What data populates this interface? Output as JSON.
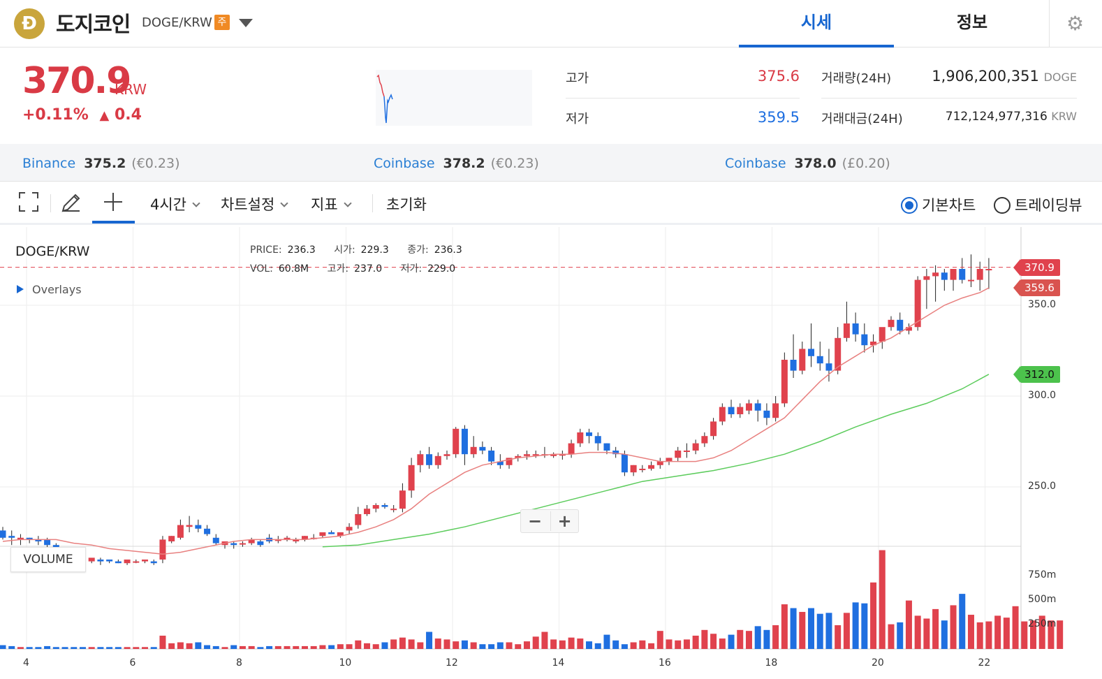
{
  "header": {
    "coin_logo_letter": "Đ",
    "coin_name": "도지코인",
    "pair": "DOGE/KRW",
    "badge": "주",
    "tabs": [
      {
        "label": "시세",
        "active": true
      },
      {
        "label": "정보",
        "active": false
      }
    ],
    "settings_icon": "gear-icon"
  },
  "price": {
    "current": "370.9",
    "unit": "KRW",
    "change_percent": "+0.11%",
    "change_arrow": "▲",
    "change_amount": "0.4"
  },
  "stats": {
    "high_label": "고가",
    "high_value": "375.6",
    "low_label": "저가",
    "low_value": "359.5",
    "volume_label": "거래량(24H)",
    "volume_value": "1,906,200,351",
    "volume_unit": "DOGE",
    "turnover_label": "거래대금(24H)",
    "turnover_value": "712,124,977,316",
    "turnover_unit": "KRW"
  },
  "exchanges": [
    {
      "name": "Binance",
      "value": "375.2",
      "fx": "(€0.23)"
    },
    {
      "name": "Coinbase",
      "value": "378.2",
      "fx": "(€0.23)"
    },
    {
      "name": "Coinbase",
      "value": "378.0",
      "fx": "(£0.20)"
    }
  ],
  "toolbar": {
    "fullscreen_icon": "fullscreen-icon",
    "pencil_icon": "pencil-icon",
    "crosshair_icon": "crosshair-icon",
    "interval": "4시간",
    "chart_settings": "차트설정",
    "indicators": "지표",
    "reset": "초기화",
    "mode_basic": "기본차트",
    "mode_tradingview": "트레이딩뷰"
  },
  "chart_header": {
    "pair": "DOGE/KRW",
    "overlays": "Overlays",
    "price_label": "PRICE:",
    "price_value": "236.3",
    "open_label": "시가:",
    "open_value": "229.3",
    "close_label": "종가:",
    "close_value": "236.3",
    "vol_label": "VOL:",
    "vol_value": "60.8M",
    "high_label": "고가:",
    "high_value": "237.0",
    "low_label": "저가:",
    "low_value": "229.0"
  },
  "chart_controls": {
    "zoom_out": "−",
    "zoom_in": "+",
    "volume_label": "VOLUME"
  },
  "price_tags": {
    "last": "370.9",
    "ma_short": "359.6",
    "ma_long": "312.0"
  },
  "colors": {
    "up": "#e0424d",
    "down": "#1f6fe0",
    "ma_short": "#e8807f",
    "ma_long": "#5ccc5c",
    "accent": "#1766d0"
  },
  "chart_data": {
    "type": "candlestick",
    "x_ticks": [
      "4",
      "6",
      "8",
      "10",
      "12",
      "14",
      "16",
      "18",
      "20",
      "22"
    ],
    "y_ticks": [
      "250.0",
      "300.0",
      "350.0"
    ],
    "volume_ticks": [
      "250m",
      "500m",
      "750m"
    ],
    "last_price": 370.9,
    "ma_short_last": 359.6,
    "ma_long_last": 312.0,
    "candles": [
      [
        226,
        228,
        222,
        221
      ],
      [
        223,
        226,
        222,
        218
      ],
      [
        221,
        224,
        222,
        218
      ],
      [
        222,
        222,
        221,
        219
      ],
      [
        221,
        223,
        220,
        218
      ],
      [
        221,
        222,
        218,
        216
      ],
      [
        218,
        219,
        215,
        214
      ],
      [
        215,
        216,
        213,
        212
      ],
      [
        213,
        214,
        211,
        209
      ],
      [
        211,
        211,
        208,
        207
      ],
      [
        209,
        210,
        211,
        208
      ],
      [
        210,
        211,
        209,
        207
      ],
      [
        210,
        210,
        209,
        208
      ],
      [
        209,
        210,
        208,
        208
      ],
      [
        208,
        209,
        210,
        207
      ],
      [
        209,
        210,
        209,
        208
      ],
      [
        209,
        210,
        210,
        208
      ],
      [
        209,
        210,
        208,
        207
      ],
      [
        210,
        223,
        221,
        208
      ],
      [
        220,
        223,
        223,
        219
      ],
      [
        222,
        232,
        229,
        221
      ],
      [
        228,
        234,
        229,
        225
      ],
      [
        229,
        232,
        227,
        225
      ],
      [
        227,
        229,
        224,
        223
      ],
      [
        222,
        224,
        219,
        218
      ],
      [
        218,
        220,
        220,
        216
      ],
      [
        219,
        220,
        218,
        216
      ],
      [
        219,
        220,
        219,
        217
      ],
      [
        219,
        222,
        221,
        218
      ],
      [
        220,
        221,
        218,
        217
      ],
      [
        222,
        224,
        220,
        219
      ],
      [
        221,
        223,
        221,
        219
      ],
      [
        221,
        223,
        222,
        220
      ],
      [
        220,
        222,
        221,
        219
      ],
      [
        221,
        223,
        223,
        220
      ],
      [
        222,
        224,
        222,
        221
      ],
      [
        223,
        224,
        225,
        222
      ],
      [
        225,
        226,
        224,
        224
      ],
      [
        223,
        224,
        225,
        222
      ],
      [
        226,
        230,
        228,
        224
      ],
      [
        229,
        239,
        235,
        227
      ],
      [
        235,
        240,
        238,
        234
      ],
      [
        238,
        241,
        240,
        236
      ],
      [
        240,
        241,
        239,
        238
      ],
      [
        238,
        240,
        238,
        236
      ],
      [
        238,
        252,
        248,
        236
      ],
      [
        248,
        266,
        262,
        244
      ],
      [
        262,
        270,
        268,
        258
      ],
      [
        268,
        272,
        262,
        260
      ],
      [
        262,
        269,
        267,
        260
      ],
      [
        267,
        270,
        268,
        265
      ],
      [
        268,
        283,
        282,
        266
      ],
      [
        282,
        284,
        268,
        262
      ],
      [
        268,
        278,
        272,
        266
      ],
      [
        272,
        275,
        270,
        268
      ],
      [
        270,
        272,
        264,
        262
      ],
      [
        264,
        268,
        262,
        260
      ],
      [
        262,
        266,
        266,
        260
      ],
      [
        266,
        268,
        267,
        264
      ],
      [
        267,
        270,
        268,
        265
      ],
      [
        268,
        270,
        268,
        266
      ],
      [
        268,
        272,
        268,
        266
      ],
      [
        267,
        269,
        268,
        266
      ],
      [
        268,
        270,
        268,
        265
      ],
      [
        268,
        276,
        274,
        266
      ],
      [
        274,
        282,
        280,
        272
      ],
      [
        280,
        282,
        278,
        274
      ],
      [
        278,
        280,
        274,
        270
      ],
      [
        274,
        274,
        270,
        268
      ],
      [
        270,
        272,
        268,
        266
      ],
      [
        268,
        270,
        258,
        256
      ],
      [
        258,
        262,
        262,
        256
      ],
      [
        260,
        262,
        260,
        258
      ],
      [
        260,
        264,
        262,
        259
      ],
      [
        262,
        266,
        264,
        260
      ],
      [
        264,
        266,
        266,
        262
      ],
      [
        266,
        272,
        270,
        264
      ],
      [
        270,
        274,
        270,
        266
      ],
      [
        270,
        276,
        274,
        268
      ],
      [
        274,
        280,
        278,
        272
      ],
      [
        278,
        288,
        286,
        276
      ],
      [
        286,
        296,
        294,
        284
      ],
      [
        294,
        298,
        290,
        288
      ],
      [
        290,
        296,
        294,
        288
      ],
      [
        292,
        298,
        296,
        290
      ],
      [
        296,
        298,
        292,
        286
      ],
      [
        292,
        296,
        288,
        284
      ],
      [
        288,
        300,
        296,
        286
      ],
      [
        296,
        324,
        320,
        294
      ],
      [
        320,
        334,
        314,
        310
      ],
      [
        314,
        330,
        326,
        312
      ],
      [
        326,
        340,
        322,
        316
      ],
      [
        322,
        330,
        318,
        314
      ],
      [
        318,
        326,
        314,
        308
      ],
      [
        314,
        338,
        332,
        312
      ],
      [
        332,
        352,
        340,
        330
      ],
      [
        340,
        346,
        334,
        330
      ],
      [
        334,
        340,
        328,
        324
      ],
      [
        328,
        334,
        330,
        324
      ],
      [
        330,
        334,
        338,
        326
      ],
      [
        338,
        344,
        342,
        336
      ],
      [
        342,
        346,
        336,
        334
      ],
      [
        336,
        340,
        338,
        334
      ],
      [
        338,
        366,
        364,
        336
      ],
      [
        364,
        370,
        366,
        348
      ],
      [
        366,
        372,
        368,
        352
      ],
      [
        368,
        370,
        364,
        358
      ],
      [
        364,
        370,
        370,
        358
      ],
      [
        370,
        376,
        364,
        362
      ],
      [
        364,
        378,
        364,
        360
      ],
      [
        364,
        374,
        370,
        358
      ],
      [
        370,
        376,
        370,
        359
      ]
    ],
    "ma_short_series": [
      [
        0,
        220
      ],
      [
        2,
        221
      ],
      [
        4,
        221
      ],
      [
        6,
        221
      ],
      [
        8,
        219
      ],
      [
        10,
        218
      ],
      [
        12,
        216
      ],
      [
        14,
        215
      ],
      [
        16,
        214
      ],
      [
        18,
        213
      ],
      [
        20,
        214
      ],
      [
        22,
        216
      ],
      [
        24,
        218
      ],
      [
        26,
        220
      ],
      [
        28,
        221
      ],
      [
        30,
        221
      ],
      [
        32,
        221
      ],
      [
        34,
        221
      ],
      [
        36,
        222
      ],
      [
        38,
        223
      ],
      [
        40,
        225
      ],
      [
        42,
        228
      ],
      [
        44,
        232
      ],
      [
        46,
        238
      ],
      [
        48,
        246
      ],
      [
        50,
        252
      ],
      [
        52,
        258
      ],
      [
        54,
        262
      ],
      [
        56,
        264
      ],
      [
        58,
        266
      ],
      [
        60,
        267
      ],
      [
        62,
        268
      ],
      [
        64,
        268
      ],
      [
        66,
        269
      ],
      [
        68,
        269
      ],
      [
        70,
        268
      ],
      [
        72,
        266
      ],
      [
        74,
        264
      ],
      [
        76,
        264
      ],
      [
        78,
        264
      ],
      [
        80,
        266
      ],
      [
        82,
        270
      ],
      [
        84,
        276
      ],
      [
        86,
        282
      ],
      [
        88,
        288
      ],
      [
        90,
        298
      ],
      [
        92,
        308
      ],
      [
        94,
        316
      ],
      [
        96,
        322
      ],
      [
        98,
        328
      ],
      [
        100,
        332
      ],
      [
        102,
        338
      ],
      [
        104,
        344
      ],
      [
        106,
        350
      ],
      [
        108,
        354
      ],
      [
        110,
        357
      ],
      [
        111,
        359.6
      ]
    ],
    "ma_long_series": [
      [
        36,
        217
      ],
      [
        40,
        218
      ],
      [
        44,
        221
      ],
      [
        48,
        224
      ],
      [
        52,
        228
      ],
      [
        56,
        233
      ],
      [
        60,
        238
      ],
      [
        64,
        243
      ],
      [
        68,
        248
      ],
      [
        72,
        253
      ],
      [
        76,
        256
      ],
      [
        80,
        259
      ],
      [
        84,
        263
      ],
      [
        88,
        268
      ],
      [
        92,
        275
      ],
      [
        96,
        283
      ],
      [
        100,
        290
      ],
      [
        104,
        296
      ],
      [
        108,
        304
      ],
      [
        111,
        312
      ]
    ],
    "volumes": [
      4,
      3,
      2,
      2,
      2,
      3,
      2,
      2,
      2,
      2,
      2,
      2,
      2,
      2,
      2,
      2,
      2,
      2,
      14,
      6,
      7,
      6,
      7,
      4,
      3,
      2,
      4,
      3,
      3,
      2,
      3,
      3,
      3,
      3,
      3,
      3,
      4,
      4,
      5,
      5,
      9,
      6,
      5,
      7,
      10,
      12,
      10,
      7,
      18,
      11,
      10,
      8,
      9,
      7,
      5,
      5,
      7,
      7,
      5,
      8,
      13,
      18,
      10,
      9,
      12,
      11,
      8,
      6,
      15,
      9,
      5,
      7,
      9,
      6,
      19,
      10,
      9,
      10,
      14,
      20,
      16,
      11,
      15,
      20,
      19,
      24,
      20,
      25,
      47,
      43,
      39,
      43,
      37,
      38,
      25,
      38,
      49,
      48,
      70,
      104,
      26,
      28,
      51,
      35,
      32,
      42,
      30,
      46,
      58,
      36,
      28,
      29,
      35,
      33,
      45,
      29,
      30,
      35,
      30,
      30
    ]
  }
}
